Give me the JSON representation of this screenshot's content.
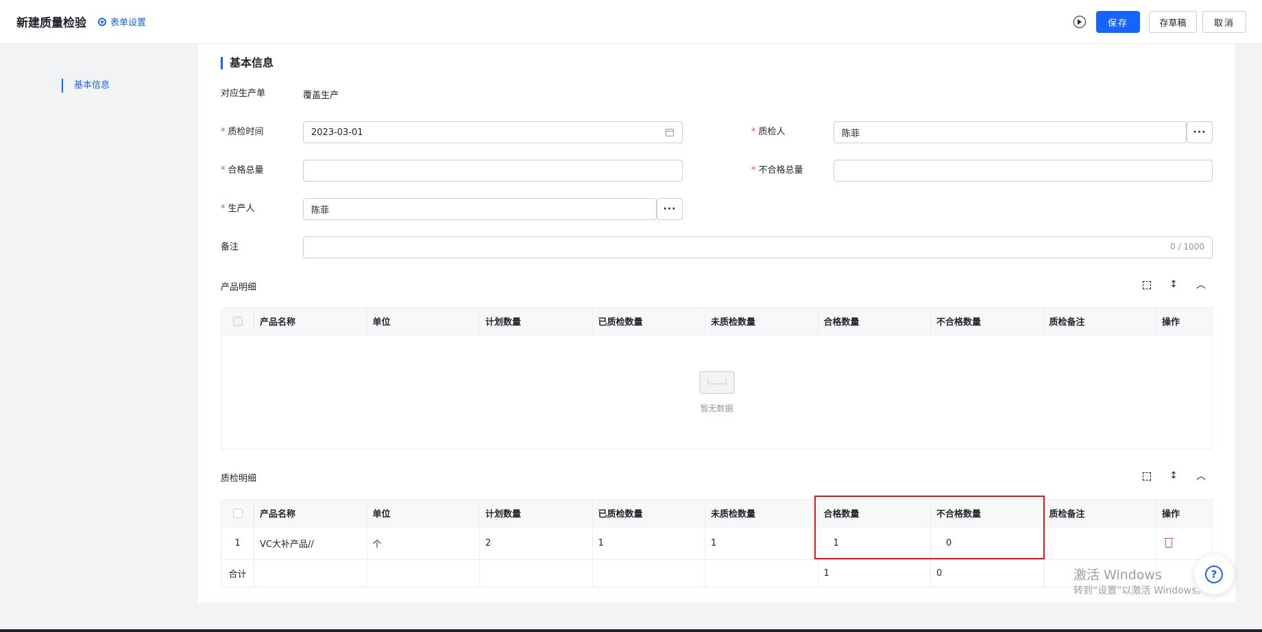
{
  "header": {
    "title": "新建质量检验",
    "form_settings": "表单设置",
    "save": "保存",
    "draft": "存草稿",
    "cancel": "取消"
  },
  "sidenav": {
    "items": [
      {
        "label": "基本信息"
      }
    ]
  },
  "section": {
    "title": "基本信息"
  },
  "form": {
    "production_order": {
      "label": "对应生产单",
      "value": "覆盖生产"
    },
    "qc_time": {
      "label": "质检时间",
      "value": "2023-03-01"
    },
    "inspector": {
      "label": "质检人",
      "value": "陈菲"
    },
    "qualified_total": {
      "label": "合格总量",
      "value": ""
    },
    "unqualified_total": {
      "label": "不合格总量",
      "value": ""
    },
    "producer": {
      "label": "生产人",
      "value": "陈菲"
    },
    "remark": {
      "label": "备注",
      "value": "",
      "counter": "0 / 1000"
    },
    "more": "···"
  },
  "product_detail": {
    "title": "产品明细",
    "columns": [
      "产品名称",
      "单位",
      "计划数量",
      "已质检数量",
      "未质检数量",
      "合格数量",
      "不合格数量",
      "质检备注",
      "操作"
    ],
    "empty": "暂无数据"
  },
  "qc_detail": {
    "title": "质检明细",
    "columns": [
      "产品名称",
      "单位",
      "计划数量",
      "已质检数量",
      "未质检数量",
      "合格数量",
      "不合格数量",
      "质检备注",
      "操作"
    ],
    "rows": [
      {
        "index": "1",
        "name": "VC大补产品//",
        "unit": "个",
        "planned": "2",
        "inspected": "1",
        "uninspected": "1",
        "qualified": "1",
        "unqualified": "0",
        "remark": ""
      }
    ],
    "summary": {
      "label": "合计",
      "qualified": "1",
      "unqualified": "0"
    }
  },
  "watermark": {
    "line1": "激活 Windows",
    "line2": "转到“设置”以激活 Windows。"
  },
  "help": "?"
}
